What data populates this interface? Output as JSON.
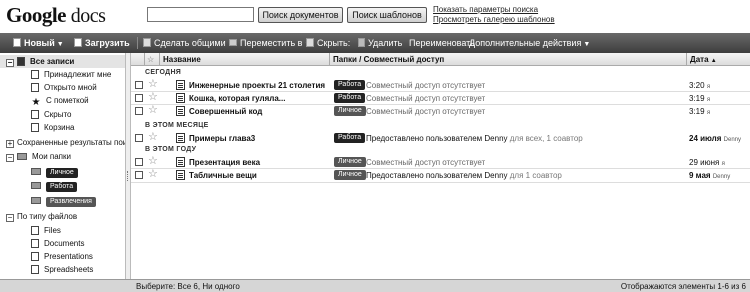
{
  "header": {
    "logo_google": "Google",
    "logo_docs": "docs",
    "search_value": "",
    "search_docs_label": "Поиск документов",
    "search_templates_label": "Поиск шаблонов",
    "link_search_options": "Показать параметры поиска",
    "link_template_gallery": "Просмотреть галерею шаблонов"
  },
  "toolbar": {
    "new_label": "Новый",
    "upload_label": "Загрузить",
    "share_label": "Сделать общими",
    "move_label": "Переместить в",
    "hide_label": "Скрыть:",
    "delete_label": "Удалить",
    "rename_label": "Переименовать",
    "more_label": "Дополнительные действия",
    "caret": "▼"
  },
  "sidebar": {
    "all_items": "Все записи",
    "items": [
      {
        "label": "Принадлежит мне",
        "icon": "owned-doc-icon"
      },
      {
        "label": "Открыто мной",
        "icon": "opened-doc-icon"
      },
      {
        "label": "С пометкой",
        "icon": "star-icon"
      },
      {
        "label": "Скрыто",
        "icon": "hidden-doc-icon"
      },
      {
        "label": "Корзина",
        "icon": "trash-icon"
      }
    ],
    "saved_search": "Сохраненные результаты пои",
    "my_folders": "Мои папки",
    "folders": [
      "Личное",
      "Работа",
      "Развлечения"
    ],
    "by_type": "По типу файлов",
    "types": [
      "Files",
      "Documents",
      "Presentations",
      "Spreadsheets"
    ]
  },
  "list": {
    "col_name": "Название",
    "col_folders": "Папки / Совместный доступ",
    "col_date": "Дата",
    "col_date_sort": "▲",
    "groups": {
      "today": "СЕГОДНЯ",
      "this_month": "В ЭТОМ МЕСЯЦЕ",
      "this_year": "В ЭТОМ ГОДУ"
    },
    "rows": [
      {
        "name": "Инженерные проекты 21 столетия",
        "tag": "Работа",
        "share": "Совместный доступ отсутствует",
        "share_ext": "",
        "date": "3:20",
        "who": "я"
      },
      {
        "name": "Кошка, которая гуляла...",
        "tag": "Работа",
        "share": "Совместный доступ отсутствует",
        "share_ext": "",
        "date": "3:19",
        "who": "я"
      },
      {
        "name": "Совершенный код",
        "tag": "Личное",
        "share": "Совместный доступ отсутствует",
        "share_ext": "",
        "date": "3:19",
        "who": "я"
      },
      {
        "name": "Примеры глава3",
        "tag": "Работа",
        "share": "Предоставлено пользователем Denny",
        "share_ext": "для всех, 1 соавтор",
        "date": "24 июля",
        "who": "Denny"
      },
      {
        "name": "Презентация века",
        "tag": "Личное",
        "share": "Совместный доступ отсутствует",
        "share_ext": "",
        "date": "29 июня",
        "who": "я"
      },
      {
        "name": "Табличные вещи",
        "tag": "Личное",
        "share": "Предоставлено пользователем Denny",
        "share_ext": "для 1 соавтор",
        "date": "9 мая",
        "who": "Denny"
      }
    ]
  },
  "status": {
    "select_text": "Выберите: Все 6, Ни одного",
    "range_text": "Отображаются элементы 1-6 из 6"
  }
}
